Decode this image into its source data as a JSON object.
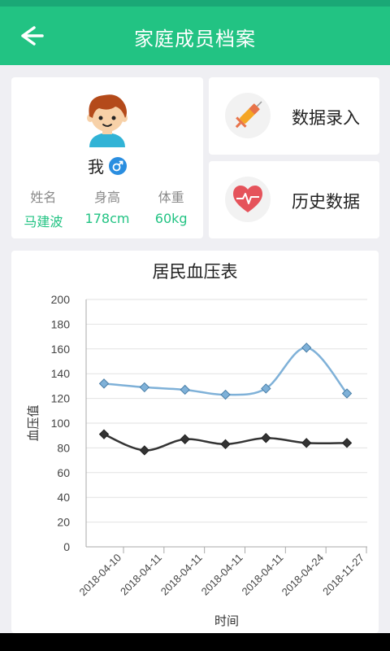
{
  "app": {
    "title": "家庭成员档案"
  },
  "profile": {
    "display_name": "我",
    "labels": {
      "name": "姓名",
      "height": "身高",
      "weight": "体重"
    },
    "values": {
      "name": "马建波",
      "height": "178cm",
      "weight": "60kg"
    }
  },
  "actions": {
    "data_entry": "数据录入",
    "history": "历史数据"
  },
  "colors": {
    "primary": "#22c383",
    "male": "#2a8ee0",
    "series_high": "#7fb1d8",
    "series_low": "#333333"
  },
  "chart_data": {
    "type": "line",
    "title": "居民血压表",
    "xlabel": "时间",
    "ylabel": "血压值",
    "categories": [
      "2018-04-10",
      "2018-04-11",
      "2018-04-11",
      "2018-04-11",
      "2018-04-11",
      "2018-04-24",
      "2018-11-27"
    ],
    "series": [
      {
        "values": [
          132,
          129,
          127,
          123,
          128,
          161,
          124
        ]
      },
      {
        "values": [
          91,
          78,
          87,
          83,
          88,
          84,
          84
        ]
      }
    ],
    "ylim": [
      0,
      200
    ],
    "yticks": [
      0,
      20,
      40,
      60,
      80,
      100,
      120,
      140,
      160,
      180,
      200
    ],
    "grid": true,
    "smooth": true,
    "marker": "diamond"
  }
}
